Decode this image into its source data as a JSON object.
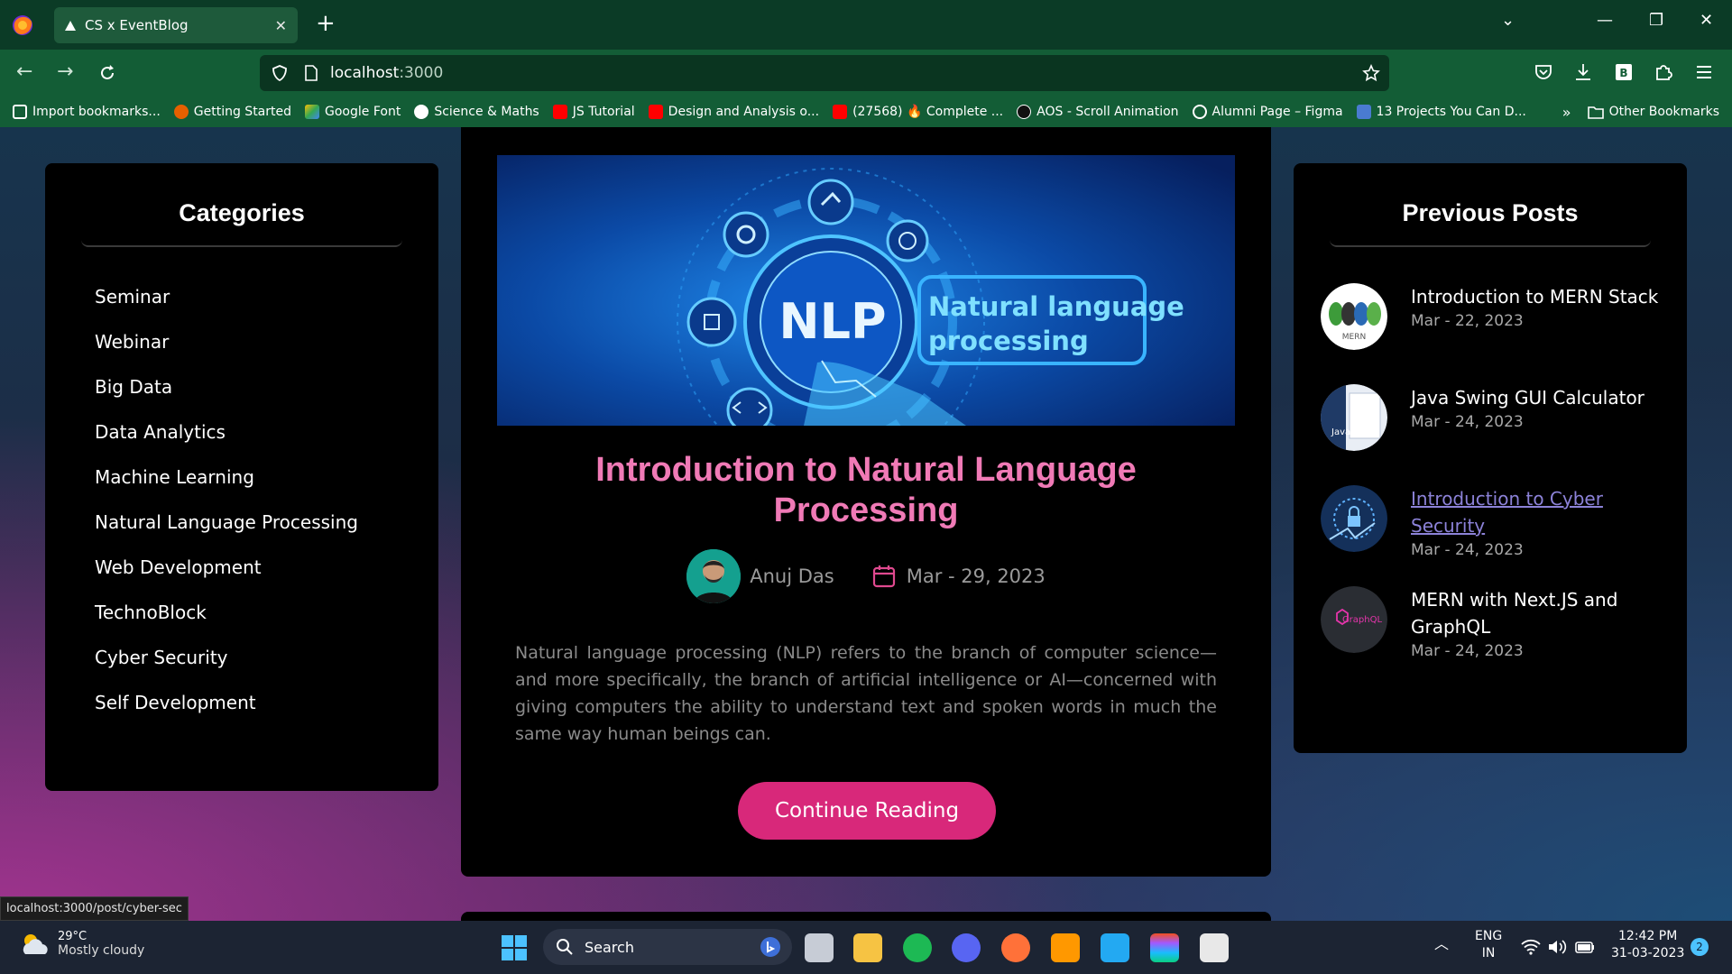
{
  "browser": {
    "tab_title": "CS x EventBlog",
    "url_host": "localhost",
    "url_port": ":3000",
    "bookmarks": [
      {
        "label": "Import bookmarks...",
        "color": "#ffffff"
      },
      {
        "label": "Getting Started",
        "color": "#e66000"
      },
      {
        "label": "Google Font",
        "color": "#fbbc05"
      },
      {
        "label": "Science & Maths",
        "color": "#ffffff"
      },
      {
        "label": "JS Tutorial",
        "color": "#ff0000"
      },
      {
        "label": "Design and Analysis o...",
        "color": "#ff0000"
      },
      {
        "label": "(27568) 🔥 Complete ...",
        "color": "#ff0000"
      },
      {
        "label": "AOS - Scroll Animation",
        "color": "#222222"
      },
      {
        "label": "Alumni Page – Figma",
        "color": "#ffffff"
      },
      {
        "label": "13 Projects You Can D...",
        "color": "#4a7bd0"
      }
    ],
    "other_bookmarks": "Other Bookmarks",
    "status_url": "localhost:3000/post/cyber-sec"
  },
  "categories": {
    "title": "Categories",
    "items": [
      "Seminar",
      "Webinar",
      "Big Data",
      "Data Analytics",
      "Machine Learning",
      "Natural Language Processing",
      "Web Development",
      "TechnoBlock",
      "Cyber Security",
      "Self Development"
    ]
  },
  "post": {
    "hero_nlp": "NLP",
    "hero_caption_1": "Natural language",
    "hero_caption_2": "processing",
    "title": "Introduction to Natural Language Processing",
    "author": "Anuj Das",
    "date": "Mar - 29, 2023",
    "excerpt": "Natural language processing (NLP) refers to the branch of computer science—and more specifically, the branch of artificial intelligence or AI—concerned with giving computers the ability to understand text and spoken words in much the same way human beings can.",
    "cta": "Continue Reading"
  },
  "previous_posts": {
    "title": "Previous Posts",
    "items": [
      {
        "title": "Introduction to MERN Stack",
        "date": "Mar - 22, 2023",
        "thumb_label": "MERN"
      },
      {
        "title": "Java Swing GUI Calculator",
        "date": "Mar - 24, 2023",
        "thumb_label": "Java"
      },
      {
        "title": "Introduction to Cyber Security",
        "date": "Mar - 24, 2023",
        "thumb_label": ""
      },
      {
        "title": "MERN with Next.JS and GraphQL",
        "date": "Mar - 24, 2023",
        "thumb_label": "GraphQL"
      }
    ]
  },
  "taskbar": {
    "temp": "29°C",
    "weather": "Mostly cloudy",
    "search": "Search",
    "lang_1": "ENG",
    "lang_2": "IN",
    "time": "12:42 PM",
    "date": "31-03-2023",
    "notifications": "2"
  }
}
